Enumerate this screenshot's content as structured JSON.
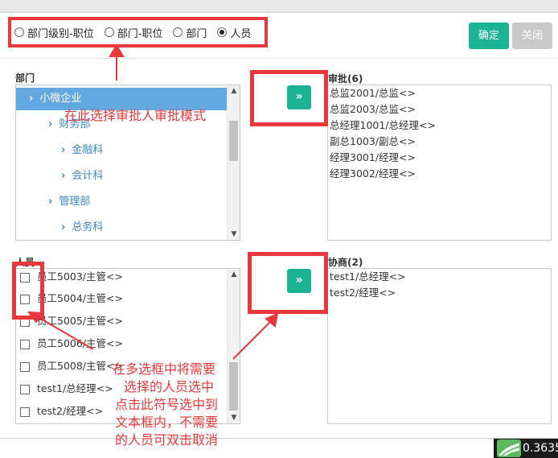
{
  "radio_options": [
    {
      "label": "部门级别-职位",
      "checked": false
    },
    {
      "label": "部门-职位",
      "checked": false
    },
    {
      "label": "部门",
      "checked": false
    },
    {
      "label": "人员",
      "checked": true
    }
  ],
  "buttons": {
    "confirm": "确定",
    "close": "关闭",
    "move": "»"
  },
  "dept_section": {
    "label": "部门",
    "tree": [
      {
        "label": "小微企业",
        "selected": true
      },
      {
        "label": "财务部"
      },
      {
        "label": "金融科"
      },
      {
        "label": "会计科"
      },
      {
        "label": "管理部"
      },
      {
        "label": "总务科"
      }
    ]
  },
  "approval": {
    "label": "审批(6)",
    "items": [
      "总监2001/总监<>",
      "总监2003/总监<>",
      "总经理1001/总经理<>",
      "副总1003/副总<>",
      "经理3001/经理<>",
      "经理3002/经理<>"
    ]
  },
  "people_section": {
    "label": "人员",
    "items": [
      "员工5003/主管<>",
      "员工5004/主管<>",
      "员工5005/主管<>",
      "员工5006/主管<>",
      "员工5008/主管<>",
      "test1/总经理<>",
      "test2/经理<>"
    ]
  },
  "consult": {
    "label": "协商(2)",
    "items": [
      "test1/总经理<>",
      "test2/经理<>"
    ]
  },
  "annotations": {
    "top": "在此选择审批人审批模式",
    "bottom": [
      "在多选框中将需要",
      "选择的人员选中",
      "点击此符号选中到",
      "文本框内，不需要",
      "的人员可双击取消"
    ]
  },
  "corner_readout": "0.3635",
  "colors": {
    "accent": "#1ab394",
    "annotation": "#e8383d",
    "tree_link": "#3a87c8",
    "tree_selected": "#63a8e0"
  }
}
